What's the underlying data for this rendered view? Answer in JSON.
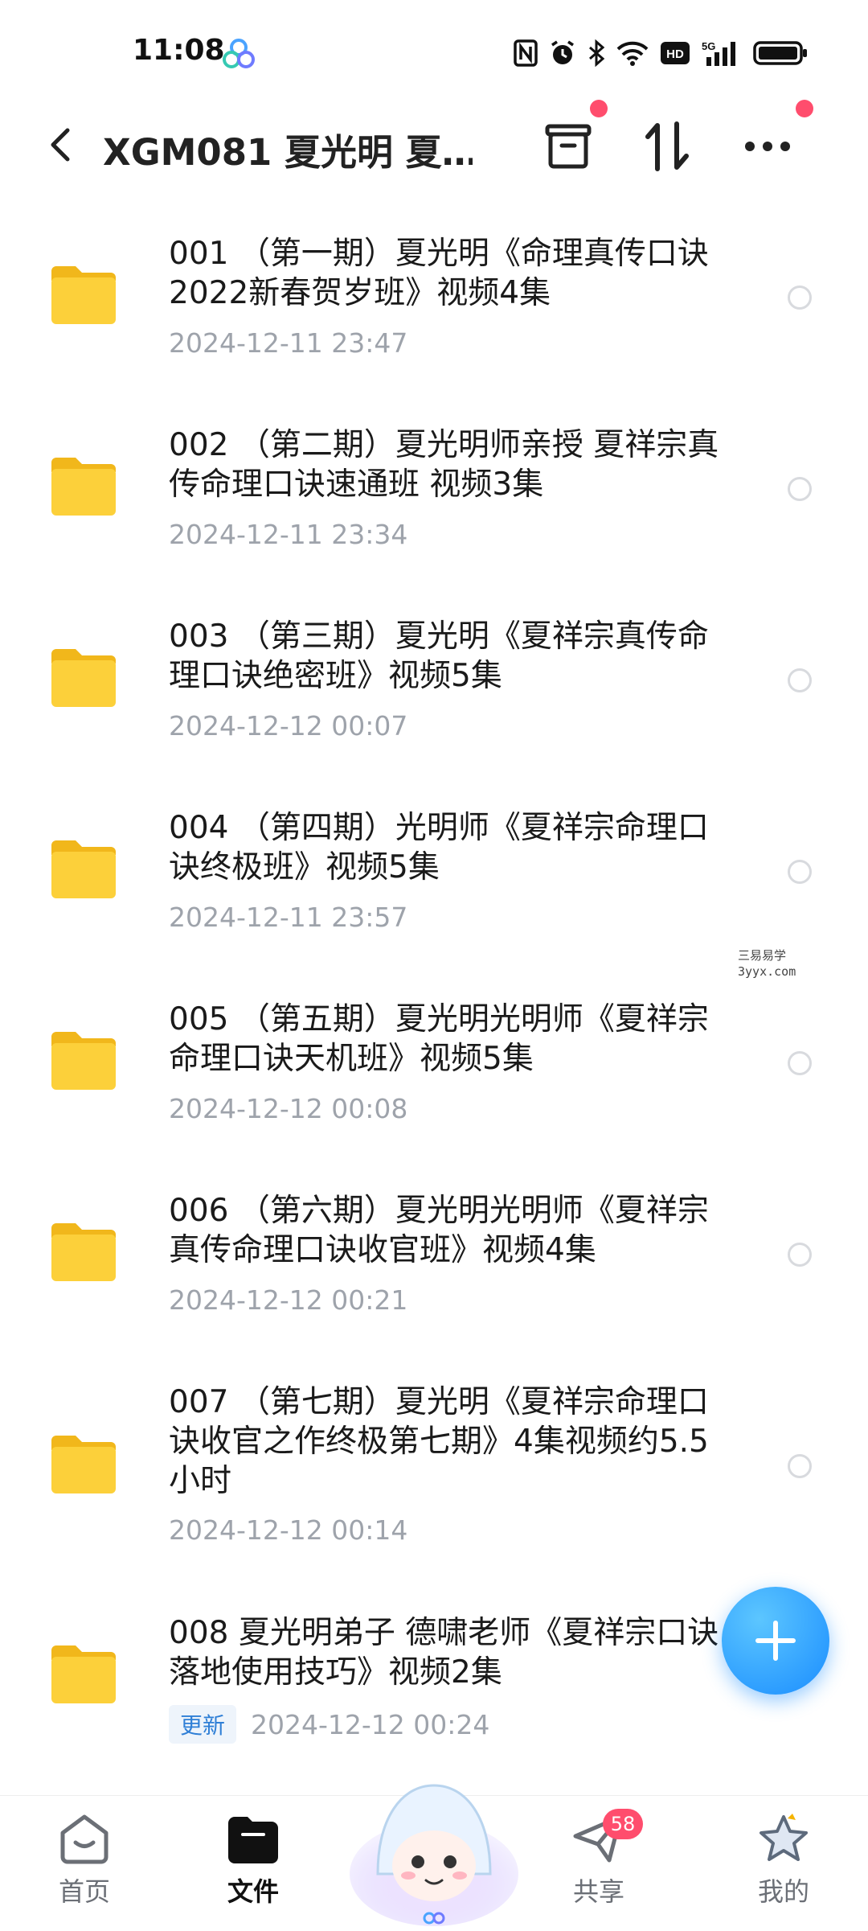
{
  "status_bar": {
    "time": "11:08",
    "icons": [
      "nfc-icon",
      "alarm-icon",
      "bluetooth-icon",
      "wifi-icon",
      "hd-icon",
      "5g-signal-icon",
      "battery-icon"
    ],
    "hd_label": "HD",
    "network_label": "5G"
  },
  "header": {
    "title": "XGM081 夏光明 夏…",
    "icons": [
      "back-icon",
      "archive-icon",
      "sort-icon",
      "more-icon"
    ]
  },
  "files": [
    {
      "name": "001 （第一期）夏光明《命理真传口诀2022新春贺岁班》视频4集",
      "date": "2024-12-11  23:47",
      "badge": ""
    },
    {
      "name": "002 （第二期）夏光明师亲授 夏祥宗真传命理口诀速通班 视频3集",
      "date": "2024-12-11  23:34",
      "badge": ""
    },
    {
      "name": "003 （第三期）夏光明《夏祥宗真传命理口诀绝密班》视频5集",
      "date": "2024-12-12  00:07",
      "badge": ""
    },
    {
      "name": "004 （第四期）光明师《夏祥宗命理口诀终极班》视频5集",
      "date": "2024-12-11  23:57",
      "badge": ""
    },
    {
      "name": "005 （第五期）夏光明光明师《夏祥宗命理口诀天机班》视频5集",
      "date": "2024-12-12  00:08",
      "badge": ""
    },
    {
      "name": "006 （第六期）夏光明光明师《夏祥宗真传命理口诀收官班》视频4集",
      "date": "2024-12-12  00:21",
      "badge": ""
    },
    {
      "name": "007 （第七期）夏光明《夏祥宗命理口诀收官之作终极第七期》4集视频约5.5小时",
      "date": "2024-12-12  00:14",
      "badge": ""
    },
    {
      "name": "008 夏光明弟子 德啸老师《夏祥宗口诀落地使用技巧》视频2集",
      "date": "2024-12-12  00:24",
      "badge": "更新"
    }
  ],
  "watermark": {
    "line1": "三易易学",
    "line2": "3yyx.com"
  },
  "bottom_nav": [
    {
      "label": "首页",
      "icon": "home-icon",
      "active": false,
      "badge": ""
    },
    {
      "label": "文件",
      "icon": "folder-icon",
      "active": true,
      "badge": ""
    },
    {
      "label": "共享",
      "icon": "send-icon",
      "active": false,
      "badge": "58"
    },
    {
      "label": "我的",
      "icon": "star-profile-icon",
      "active": false,
      "badge": ""
    }
  ],
  "colors": {
    "accent": "#1a8dff",
    "badge_red": "#ff4d6d",
    "folder": "#f9c52b",
    "meta": "#9ea3ab"
  }
}
